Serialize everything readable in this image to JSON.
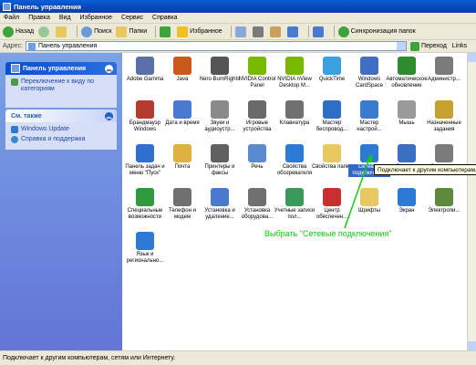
{
  "window": {
    "title": "Панель управления"
  },
  "menu": [
    "Файл",
    "Правка",
    "Вид",
    "Избранное",
    "Сервис",
    "Справка"
  ],
  "toolbar": {
    "back": "Назад",
    "search": "Поиск",
    "folders": "Папки",
    "favorites": "Избранное",
    "sync": "Синхронизация папок"
  },
  "address": {
    "label": "Адрес:",
    "value": "Панель управления",
    "go": "Переход",
    "links": "Links"
  },
  "sidebar": {
    "panel1_title": "Панель управления",
    "panel1_link": "Переключение к виду по категориям",
    "panel2_title": "См. также",
    "panel2_links": [
      "Windows Update",
      "Справка и поддержка"
    ]
  },
  "items": [
    {
      "label": "Adobe Gamma",
      "icon": "monitor-icon",
      "color": "#5a6ea8"
    },
    {
      "label": "Java",
      "icon": "java-icon",
      "color": "#c85a1e"
    },
    {
      "label": "Nero BurnRights",
      "icon": "nero-icon",
      "color": "#555555"
    },
    {
      "label": "NVIDIA Control Panel",
      "icon": "nvidia-icon",
      "color": "#76b900"
    },
    {
      "label": "NVIDIA nView Desktop M...",
      "icon": "nview-icon",
      "color": "#76b900"
    },
    {
      "label": "QuickTime",
      "icon": "quicktime-icon",
      "color": "#3aa0e0"
    },
    {
      "label": "Windows CardSpace",
      "icon": "cardspace-icon",
      "color": "#3e6fc2"
    },
    {
      "label": "Автоматическое обновление",
      "icon": "update-icon",
      "color": "#2e8b2e"
    },
    {
      "label": "Администр...",
      "icon": "admin-tools-icon",
      "color": "#7a7a7a"
    },
    {
      "label": "Брандмауэр Windows",
      "icon": "firewall-icon",
      "color": "#b33c2e"
    },
    {
      "label": "Дата и время",
      "icon": "clock-icon",
      "color": "#4a7ad0"
    },
    {
      "label": "Звуки и аудиоустр...",
      "icon": "speaker-icon",
      "color": "#8a8a8a"
    },
    {
      "label": "Игровые устройства",
      "icon": "gamepad-icon",
      "color": "#6a6a6a"
    },
    {
      "label": "Клавиатура",
      "icon": "keyboard-icon",
      "color": "#707070"
    },
    {
      "label": "Мастер беспровод...",
      "icon": "wireless-icon",
      "color": "#2c6fc7"
    },
    {
      "label": "Мастер настрой...",
      "icon": "network-wizard-icon",
      "color": "#3a7ad0"
    },
    {
      "label": "Мышь",
      "icon": "mouse-icon",
      "color": "#9a9a9a"
    },
    {
      "label": "Назначенные задания",
      "icon": "tasks-icon",
      "color": "#c8a030"
    },
    {
      "label": "Панель задач и меню \"Пуск\"",
      "icon": "taskbar-icon",
      "color": "#2e6fd0"
    },
    {
      "label": "Почта",
      "icon": "mail-icon",
      "color": "#e0b040"
    },
    {
      "label": "Принтеры и факсы",
      "icon": "printer-icon",
      "color": "#606060"
    },
    {
      "label": "Речь",
      "icon": "speech-icon",
      "color": "#5a8ad0"
    },
    {
      "label": "Свойства обозревателя",
      "icon": "ie-icon",
      "color": "#2b7bd4"
    },
    {
      "label": "Свойства папки",
      "icon": "folder-icon",
      "color": "#e8c860"
    },
    {
      "label": "Сетевые подключения",
      "icon": "network-connections-icon",
      "color": "#2b7bd4"
    },
    {
      "label": "Система",
      "icon": "system-icon",
      "color": "#3a6ec0"
    },
    {
      "label": "Сканеры и камеры",
      "icon": "scanner-icon",
      "color": "#7a7a7a"
    },
    {
      "label": "Специальные возможности",
      "icon": "accessibility-icon",
      "color": "#2e9a3e"
    },
    {
      "label": "Телефон и модем",
      "icon": "phone-icon",
      "color": "#707070"
    },
    {
      "label": "Установка и удаление...",
      "icon": "add-remove-icon",
      "color": "#4a7ad0"
    },
    {
      "label": "Установка оборудова...",
      "icon": "hardware-icon",
      "color": "#707070"
    },
    {
      "label": "Учетные записи пол...",
      "icon": "users-icon",
      "color": "#3a9a5a"
    },
    {
      "label": "Центр обеспечен...",
      "icon": "security-center-icon",
      "color": "#c83030"
    },
    {
      "label": "Шрифты",
      "icon": "fonts-icon",
      "color": "#e8c860"
    },
    {
      "label": "Экран",
      "icon": "display-icon",
      "color": "#2b7bd4"
    },
    {
      "label": "Электропи...",
      "icon": "power-icon",
      "color": "#5a8a3a"
    },
    {
      "label": "Язык и регионально...",
      "icon": "globe-icon",
      "color": "#2b7bd4"
    }
  ],
  "tooltip": "Подключает к другим компьютерам, сетям и Интернету.",
  "annotation": "Выбрать \"Сетевые подключения\"",
  "status": "Подключает к другим компьютерам, сетям или Интернету."
}
